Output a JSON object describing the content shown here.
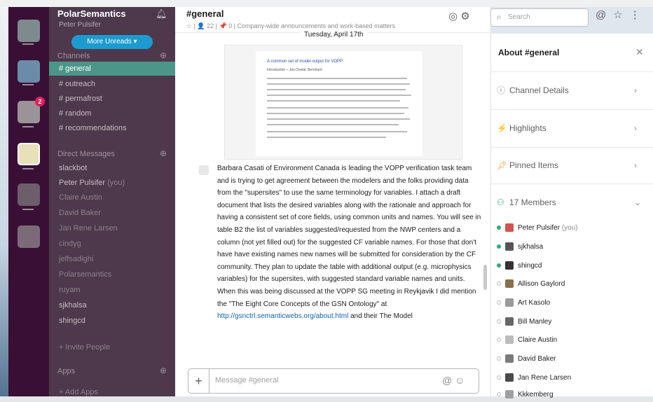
{
  "workspace": {
    "name": "PolarSemantics",
    "user": "Peter Pulsifer",
    "more_unreads": "More Unreads",
    "rail_badge": "2"
  },
  "sidebar": {
    "channels_header": "Channels",
    "channels": [
      {
        "label": "# general",
        "active": true
      },
      {
        "label": "# outreach"
      },
      {
        "label": "# permafrost"
      },
      {
        "label": "# random"
      },
      {
        "label": "# recommendations"
      }
    ],
    "dm_header": "Direct Messages",
    "dms": [
      {
        "label": "slackbot"
      },
      {
        "label": "Peter Pulsifer",
        "suffix": "(you)"
      },
      {
        "label": "Claire Austin"
      },
      {
        "label": "David Baker"
      },
      {
        "label": "Jan Rene Larsen"
      },
      {
        "label": "cindyg"
      },
      {
        "label": "jeffsadighi"
      },
      {
        "label": "Polarsemantics"
      },
      {
        "label": "ruyam"
      },
      {
        "label": "sjkhalsa"
      },
      {
        "label": "shingcd"
      }
    ],
    "invite": "+ Invite People",
    "apps_header": "Apps",
    "add_apps": "+ Add Apps"
  },
  "channel": {
    "title": "#general",
    "meta": "☆ | 👤 22 | 📌 0 | Company-wide announcements and work-based matters",
    "date": "Tuesday, April 17th",
    "doc_title": "A common set of model output for VOPP",
    "doc_subtitle": "Introduction – Jan Dostal, Bernhard",
    "message": "Barbara Casati of Environment Canada is leading the VOPP verification task team and is trying to get agreement between the modelers and the folks providing data from the \"supersites\" to use the same terminology for variables. I attach a draft document that lists the desired variables along with the rationale and approach for having a consistent set of core fields, using common units and names. You will see in table B2 the list of variables suggested/requested from the NWP centers and a column (not yet filled out) for the suggested CF variable names. For those that don't have have existing names new names will be submitted for consideration by the CF community. They plan to update the table with additional output (e.g. microphysics variables) for the supersites, with suggested standard variable names and units. When this was being discussed at the VOPP SG meeting in Reykjavik I did mention the \"The Eight Core Concepts of the GSN Ontology\" at",
    "message_link": "http://gsnctrl.semanticwebs.org/about.html",
    "message_tail": "and their The Model",
    "composer_placeholder": "Message #general"
  },
  "search": {
    "placeholder": "Search"
  },
  "about": {
    "title": "About #general",
    "sections": [
      {
        "label": "Channel Details",
        "icon": "info-icon"
      },
      {
        "label": "Highlights",
        "icon": "highlights-icon"
      },
      {
        "label": "Pinned Items",
        "icon": "pin-icon"
      },
      {
        "label": "17 Members",
        "icon": "members-icon"
      }
    ],
    "members": [
      {
        "name": "Peter Pulsifer",
        "suffix": "(you)",
        "online": true
      },
      {
        "name": "sjkhalsa",
        "online": true
      },
      {
        "name": "shingcd",
        "online": true
      },
      {
        "name": "Allison Gaylord",
        "online": false
      },
      {
        "name": "Art Kasolo",
        "online": false
      },
      {
        "name": "Bill Manley",
        "online": false
      },
      {
        "name": "Claire Austin",
        "online": false
      },
      {
        "name": "David Baker",
        "online": false
      },
      {
        "name": "Jan Rene Larsen",
        "online": false
      },
      {
        "name": "Kkkemberg",
        "online": false
      }
    ]
  },
  "colors": {
    "rail_bg": "#3a0f35",
    "sidebar_bg": "#4d394b",
    "active_channel": "#4c9689",
    "unreads_button": "#1d9bd1",
    "link": "#1264a3",
    "presence_online": "#2bac76"
  }
}
